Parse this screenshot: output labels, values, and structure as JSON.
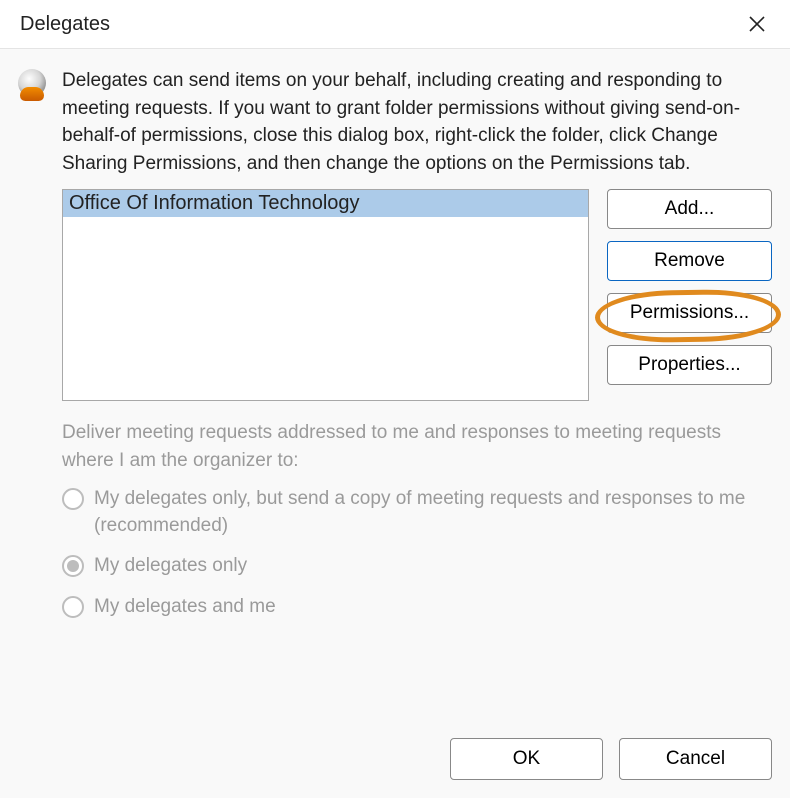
{
  "title": "Delegates",
  "description": "Delegates can send items on your behalf, including creating and responding to meeting requests. If you want to grant folder permissions without giving send-on-behalf-of permissions, close this dialog box, right-click the folder, click Change Sharing Permissions, and then change the options on the Permissions tab.",
  "list": {
    "items": [
      {
        "name": "Office Of Information Technology",
        "selected": true
      }
    ]
  },
  "buttons": {
    "add": "Add...",
    "remove": "Remove",
    "permissions": "Permissions...",
    "properties": "Properties..."
  },
  "delivery_section_label": "Deliver meeting requests addressed to me and responses to meeting requests where I am the organizer to:",
  "radios": {
    "opt1": "My delegates only, but send a copy of meeting requests and responses to me (recommended)",
    "opt2": "My delegates only",
    "opt3": "My delegates and me",
    "selected": "opt2",
    "disabled": true
  },
  "footer": {
    "ok": "OK",
    "cancel": "Cancel"
  },
  "annotation": {
    "highlighted_button": "permissions"
  }
}
